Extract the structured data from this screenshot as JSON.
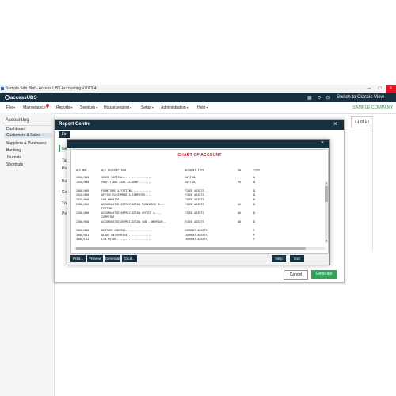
{
  "window": {
    "title": "Sample Sdn Bhd - Access UBS Accounting v2023.4",
    "minimize": "–",
    "maximize": "□",
    "close": "×"
  },
  "brand": {
    "logo": "accessUBS",
    "switch_label": "Switch to Classic View"
  },
  "menu": {
    "items": [
      "File",
      "Maintenance",
      "Reports",
      "Services",
      "Housekeeping",
      "Setup",
      "Administration",
      "Help"
    ],
    "chevron": "▾",
    "company": "SAMPLE COMPANY"
  },
  "nav": {
    "heading": "Accounting",
    "items": [
      "Dashboard",
      "Customers & Sales",
      "Suppliers & Purchases",
      "Banking",
      "Journals",
      "Shortcuts"
    ]
  },
  "pager": {
    "label": "‹ 1 of 1 ›"
  },
  "report_centre": {
    "title": "Report Centre",
    "close": "×",
    "side_tabs": [
      "Fin",
      "Ge",
      "Tax",
      "Pro",
      "Ba",
      "Co",
      "Tra",
      "Per"
    ],
    "cancel_label": "Cancel",
    "generate_label": "Generate"
  },
  "preview": {
    "close": "×",
    "title": "CHART OF ACCOUNT",
    "headers": {
      "ac_no": "A/C NO.",
      "desc": "A/C DESCRIPTION",
      "type": "ACCOUNT TYPE",
      "sa": "SA",
      "type2": "TYPE"
    },
    "rows": [
      {
        "ac_no": "1000/000",
        "desc": "SHARE CAPITAL..................",
        "type": "CAPITAL",
        "sa": "",
        "type2": "A"
      },
      {
        "ac_no": "1050/000",
        "desc": "PROFIT AND LOSS ACCOUNT........",
        "type": "CAPITAL",
        "sa": "PA",
        "type2": "A"
      },
      {
        "ac_no": "",
        "desc": "",
        "type": "",
        "sa": "",
        "type2": ""
      },
      {
        "ac_no": "2000/000",
        "desc": "FURNITURE & FITTING............",
        "type": "FIXED ASSETS",
        "sa": "",
        "type2": "D"
      },
      {
        "ac_no": "2020/000",
        "desc": "OFFICE EQUIPMENT & COMPUTER....",
        "type": "FIXED ASSETS",
        "sa": "",
        "type2": "D"
      },
      {
        "ac_no": "2030/000",
        "desc": "VAN-WBF6109....................",
        "type": "FIXED ASSETS",
        "sa": "",
        "type2": "D"
      },
      {
        "ac_no": "2100/000",
        "desc": "ACCUMULATED DEPRECIATION FURNITURE &...",
        "type": "FIXED ASSETS",
        "sa": "AD",
        "type2": "D"
      },
      {
        "ac_no": "",
        "desc": "FITTING",
        "type": "",
        "sa": "",
        "type2": ""
      },
      {
        "ac_no": "2200/000",
        "desc": "ACCUMULATED DEPRECIATION OFFICE &....",
        "type": "FIXED ASSETS",
        "sa": "AD",
        "type2": "D"
      },
      {
        "ac_no": "",
        "desc": "COMPUTER",
        "type": "",
        "sa": "",
        "type2": ""
      },
      {
        "ac_no": "2300/000",
        "desc": "ACCUMULATED DEPRECIATION VAN - WBF6109..",
        "type": "FIXED ASSETS",
        "sa": "AD",
        "type2": "D"
      },
      {
        "ac_no": "",
        "desc": "",
        "type": "",
        "sa": "",
        "type2": ""
      },
      {
        "ac_no": "3000/000",
        "desc": "DEBTORS CONTROL................",
        "type": "CURRENT ASSETS",
        "sa": "",
        "type2": "F"
      },
      {
        "ac_no": "3000/A01",
        "desc": "ALIAS ENTERPRISE...............",
        "type": "CURRENT ASSETS",
        "sa": "",
        "type2": "F"
      },
      {
        "ac_no": "3000/L01",
        "desc": "LIN MOTOR......................",
        "type": "CURRENT ASSETS",
        "sa": "",
        "type2": "F"
      }
    ],
    "buttons": [
      "Print...",
      "Preview",
      "Generate",
      "Excel...",
      "Help",
      "Exit"
    ]
  }
}
